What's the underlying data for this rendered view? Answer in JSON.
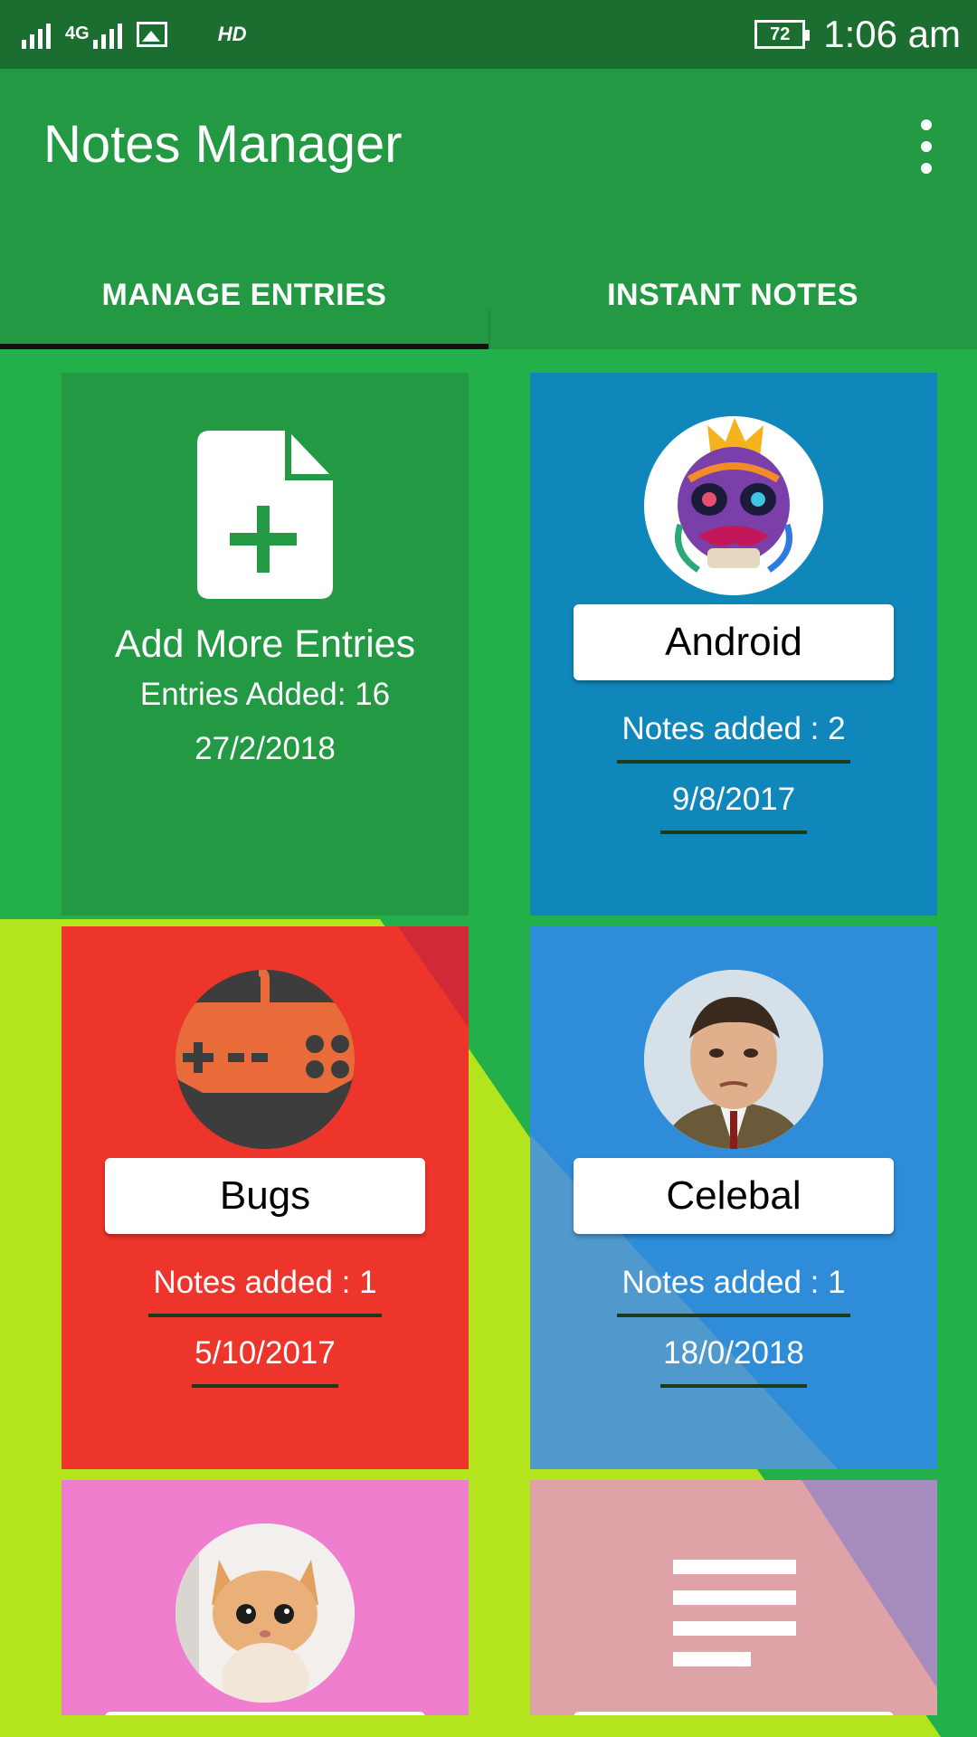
{
  "status_bar": {
    "network_type": "4G",
    "hd_label": "HD",
    "battery": "72",
    "time": "1:06 am"
  },
  "app_bar": {
    "title": "Notes Manager",
    "menu_icon": "more-vert-icon"
  },
  "tabs": [
    {
      "label": "MANAGE ENTRIES",
      "selected": true
    },
    {
      "label": "INSTANT NOTES",
      "selected": false
    }
  ],
  "add_card": {
    "title": "Add More Entries",
    "entries_added": "Entries Added: 16",
    "date": "27/2/2018",
    "icon": "add-document-icon",
    "color": "#229942"
  },
  "entries": [
    {
      "name": "Android",
      "notes": "Notes added : 2",
      "date": "9/8/2017",
      "color": "#1087bb",
      "avatar": "skull-art"
    },
    {
      "name": "Bugs",
      "notes": "Notes added : 1",
      "date": "5/10/2017",
      "color": "#ee352b",
      "avatar": "gamepad-icon"
    },
    {
      "name": "Celebal",
      "notes": "Notes added : 1",
      "date": "18/0/2018",
      "color": "#2e8cd9",
      "avatar": "man-portrait"
    },
    {
      "name": "",
      "notes": "",
      "date": "",
      "color": "#ef7fce",
      "avatar": "kitten-photo"
    },
    {
      "name": "",
      "notes": "",
      "date": "",
      "color": "#dfa2a7",
      "avatar": "notes-lines-icon"
    }
  ],
  "colors": {
    "status_bar": "#1b6e30",
    "primary": "#229942",
    "background_lime": "#b4e41e",
    "background_green": "#23b04a"
  }
}
